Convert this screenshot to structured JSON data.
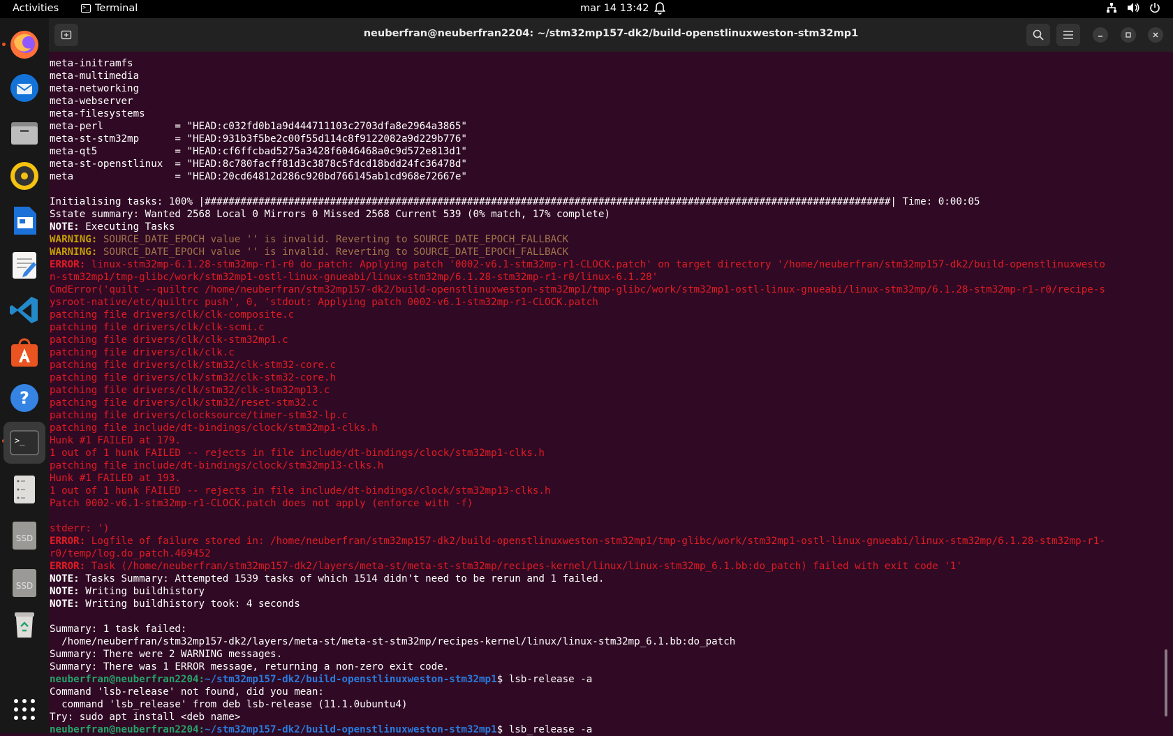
{
  "topbar": {
    "activities": "Activities",
    "app_name": "Terminal",
    "clock": "mar 14  13:42"
  },
  "dock": {
    "items": [
      "firefox",
      "thunderbird",
      "files",
      "rhythmbox",
      "libreoffice-impress",
      "text-editor",
      "vscode",
      "app-center",
      "help",
      "terminal",
      "disks",
      "ssd-1",
      "ssd-2",
      "trash",
      "show-apps"
    ],
    "accent_color": "#e95420"
  },
  "window": {
    "title": "neuberfran@neuberfran2204: ~/stm32mp157-dk2/build-openstlinuxweston-stm32mp1"
  },
  "terminal": {
    "lines": [
      {
        "text": "meta-initramfs"
      },
      {
        "text": "meta-multimedia"
      },
      {
        "text": "meta-networking"
      },
      {
        "text": "meta-webserver"
      },
      {
        "text": "meta-filesystems"
      },
      {
        "text": "meta-perl            = \"HEAD:c032fd0b1a9d444711103c2703dfa8e2964a3865\""
      },
      {
        "text": "meta-st-stm32mp      = \"HEAD:931b3f5be2c00f55d114c8f9122082a9d229b776\""
      },
      {
        "text": "meta-qt5             = \"HEAD:cf6ffcbad5275a3428f6046468a0c9d572e813d1\""
      },
      {
        "text": "meta-st-openstlinux  = \"HEAD:8c780facff81d3c3878c5fdcd18bdd24fc36478d\""
      },
      {
        "text": "meta                 = \"HEAD:20cd64812d286c920bd766145ab1cd968e72667e\""
      },
      {
        "text": ""
      },
      {
        "text": "Initialising tasks: 100% |###################################################################################################################| Time: 0:00:05"
      },
      {
        "text": "Sstate summary: Wanted 2568 Local 0 Mirrors 0 Missed 2568 Current 539 (0% match, 17% complete)"
      },
      {
        "prefix": "NOTE:",
        "prefix_style": "bold",
        "text": " Executing Tasks"
      },
      {
        "prefix": "WARNING:",
        "prefix_style": "yellow",
        "text": " SOURCE_DATE_EPOCH value '' is invalid. Reverting to SOURCE_DATE_EPOCH_FALLBACK",
        "style": "warn-y"
      },
      {
        "prefix": "WARNING:",
        "prefix_style": "yellow",
        "text": " SOURCE_DATE_EPOCH value '' is invalid. Reverting to SOURCE_DATE_EPOCH_FALLBACK",
        "style": "warn-y"
      },
      {
        "prefix": "ERROR:",
        "prefix_style": "red",
        "text": " linux-stm32mp-6.1.28-stm32mp-r1-r0 do_patch: Applying patch '0002-v6.1-stm32mp-r1-CLOCK.patch' on target directory '/home/neuberfran/stm32mp157-dk2/build-openstlinuxwesto",
        "style": "red"
      },
      {
        "text": "n-stm32mp1/tmp-glibc/work/stm32mp1-ostl-linux-gnueabi/linux-stm32mp/6.1.28-stm32mp-r1-r0/linux-6.1.28'",
        "style": "red"
      },
      {
        "text": "CmdError('quilt --quiltrc /home/neuberfran/stm32mp157-dk2/build-openstlinuxweston-stm32mp1/tmp-glibc/work/stm32mp1-ostl-linux-gnueabi/linux-stm32mp/6.1.28-stm32mp-r1-r0/recipe-s",
        "style": "red"
      },
      {
        "text": "ysroot-native/etc/quiltrc push', 0, 'stdout: Applying patch 0002-v6.1-stm32mp-r1-CLOCK.patch",
        "style": "red"
      },
      {
        "text": "patching file drivers/clk/clk-composite.c",
        "style": "red"
      },
      {
        "text": "patching file drivers/clk/clk-scmi.c",
        "style": "red"
      },
      {
        "text": "patching file drivers/clk/clk-stm32mp1.c",
        "style": "red"
      },
      {
        "text": "patching file drivers/clk/clk.c",
        "style": "red"
      },
      {
        "text": "patching file drivers/clk/stm32/clk-stm32-core.c",
        "style": "red"
      },
      {
        "text": "patching file drivers/clk/stm32/clk-stm32-core.h",
        "style": "red"
      },
      {
        "text": "patching file drivers/clk/stm32/clk-stm32mp13.c",
        "style": "red"
      },
      {
        "text": "patching file drivers/clk/stm32/reset-stm32.c",
        "style": "red"
      },
      {
        "text": "patching file drivers/clocksource/timer-stm32-lp.c",
        "style": "red"
      },
      {
        "text": "patching file include/dt-bindings/clock/stm32mp1-clks.h",
        "style": "red"
      },
      {
        "text": "Hunk #1 FAILED at 179.",
        "style": "red"
      },
      {
        "text": "1 out of 1 hunk FAILED -- rejects in file include/dt-bindings/clock/stm32mp1-clks.h",
        "style": "red"
      },
      {
        "text": "patching file include/dt-bindings/clock/stm32mp13-clks.h",
        "style": "red"
      },
      {
        "text": "Hunk #1 FAILED at 193.",
        "style": "red"
      },
      {
        "text": "1 out of 1 hunk FAILED -- rejects in file include/dt-bindings/clock/stm32mp13-clks.h",
        "style": "red"
      },
      {
        "text": "Patch 0002-v6.1-stm32mp-r1-CLOCK.patch does not apply (enforce with -f)",
        "style": "red"
      },
      {
        "text": ""
      },
      {
        "text": "stderr: ')",
        "style": "red"
      },
      {
        "prefix": "ERROR:",
        "prefix_style": "red",
        "text": " Logfile of failure stored in: /home/neuberfran/stm32mp157-dk2/build-openstlinuxweston-stm32mp1/tmp-glibc/work/stm32mp1-ostl-linux-gnueabi/linux-stm32mp/6.1.28-stm32mp-r1-",
        "style": "red"
      },
      {
        "text": "r0/temp/log.do_patch.469452",
        "style": "red"
      },
      {
        "prefix": "ERROR:",
        "prefix_style": "red",
        "text": " Task (/home/neuberfran/stm32mp157-dk2/layers/meta-st/meta-st-stm32mp/recipes-kernel/linux/linux-stm32mp_6.1.bb:do_patch) failed with exit code '1'",
        "style": "red"
      },
      {
        "prefix": "NOTE:",
        "prefix_style": "bold",
        "text": " Tasks Summary: Attempted 1539 tasks of which 1514 didn't need to be rerun and 1 failed."
      },
      {
        "prefix": "NOTE:",
        "prefix_style": "bold",
        "text": " Writing buildhistory"
      },
      {
        "prefix": "NOTE:",
        "prefix_style": "bold",
        "text": " Writing buildhistory took: 4 seconds"
      },
      {
        "text": ""
      },
      {
        "text": "Summary: 1 task failed:"
      },
      {
        "text": "  /home/neuberfran/stm32mp157-dk2/layers/meta-st/meta-st-stm32mp/recipes-kernel/linux/linux-stm32mp_6.1.bb:do_patch"
      },
      {
        "text": "Summary: There were 2 WARNING messages."
      },
      {
        "text": "Summary: There was 1 ERROR message, returning a non-zero exit code."
      },
      {
        "user": "neuberfran@neuberfran2204",
        "path": "~/stm32mp157-dk2/build-openstlinuxweston-stm32mp1",
        "text": "$ lsb-release -a"
      },
      {
        "text": "Command 'lsb-release' not found, did you mean:"
      },
      {
        "text": "  command 'lsb_release' from deb lsb-release (11.1.0ubuntu4)"
      },
      {
        "text": "Try: sudo apt install <deb name>"
      },
      {
        "user": "neuberfran@neuberfran2204",
        "path": "~/stm32mp157-dk2/build-openstlinuxweston-stm32mp1",
        "text": "$ lsb_release -a"
      }
    ]
  }
}
